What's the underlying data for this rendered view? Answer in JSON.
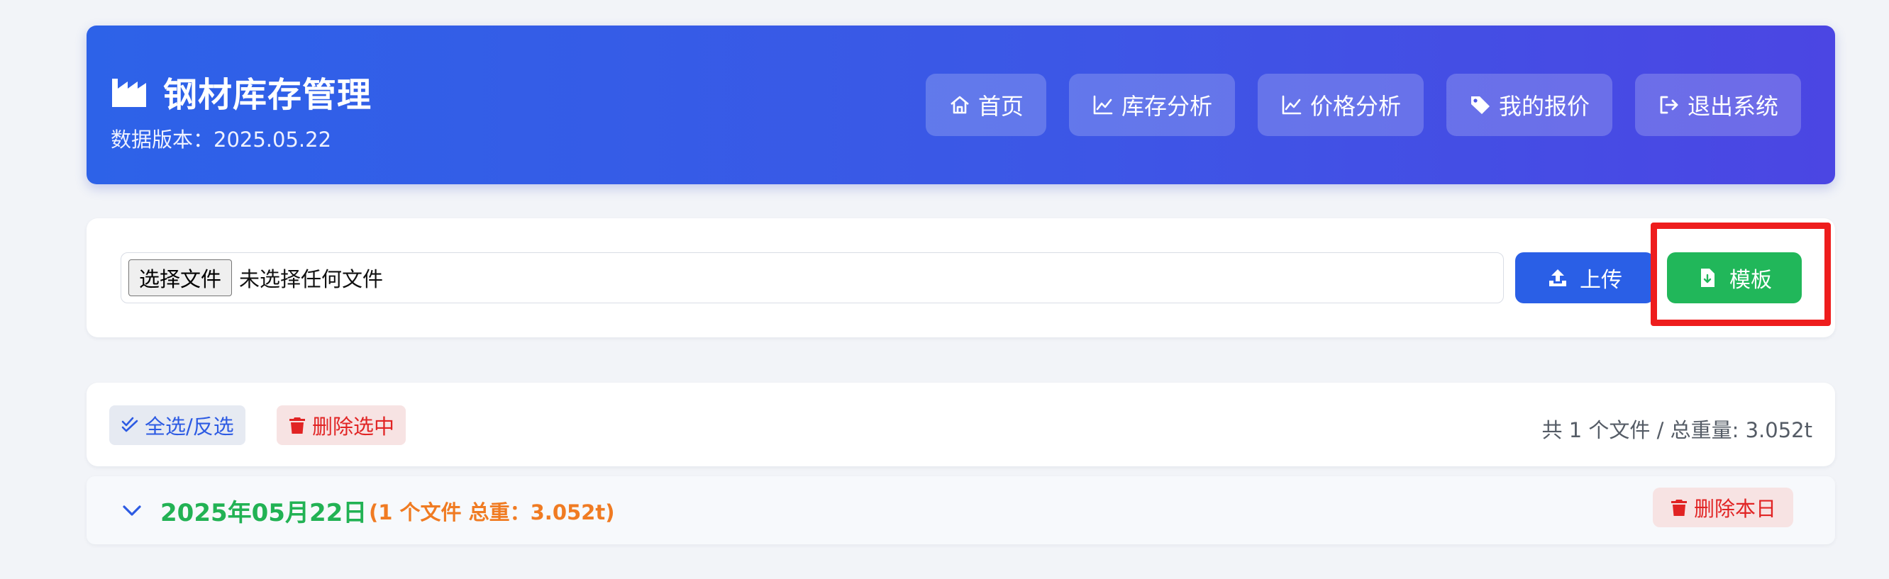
{
  "header": {
    "title": "钢材库存管理",
    "version_label": "数据版本：2025.05.22",
    "icon": "factory-icon"
  },
  "nav": {
    "items": [
      {
        "label": "首页",
        "icon": "home-icon"
      },
      {
        "label": "库存分析",
        "icon": "line-chart-icon"
      },
      {
        "label": "价格分析",
        "icon": "line-chart-icon"
      },
      {
        "label": "我的报价",
        "icon": "tag-icon"
      },
      {
        "label": "退出系统",
        "icon": "logout-icon"
      }
    ]
  },
  "upload": {
    "choose_label": "选择文件",
    "file_status": "未选择任何文件",
    "upload_label": "上传",
    "template_label": "模板"
  },
  "file_list": {
    "select_all_label": "全选/反选",
    "delete_selected_label": "删除选中",
    "summary": "共 1 个文件 / 总重量: 3.052t",
    "groups": [
      {
        "date": "2025年05月22日",
        "meta": "(1 个文件 总重：3.052t)",
        "delete_label": "删除本日"
      }
    ]
  },
  "colors": {
    "header_start": "#2d62e8",
    "header_end": "#4b46e3",
    "primary": "#2a5fe6",
    "success": "#21b75a",
    "danger": "#e12424",
    "warning": "#f07b22",
    "highlight": "#ee1d1d"
  }
}
